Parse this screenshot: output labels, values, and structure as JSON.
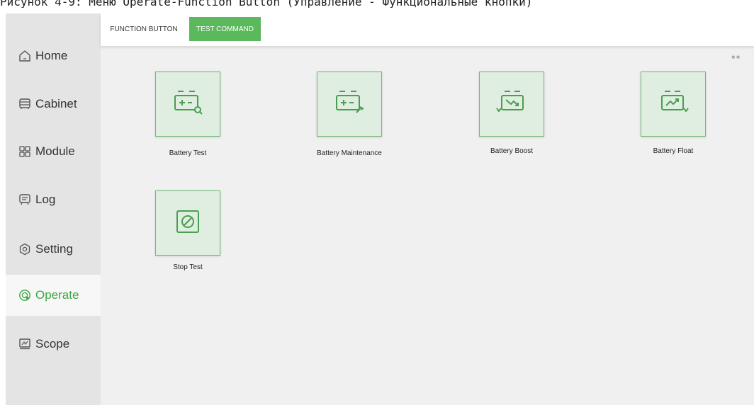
{
  "caption": "Рисунок 4-9: Меню Operate-Function Button (Управление - Функциональные кнопки)",
  "sidebar": {
    "items": [
      {
        "label": "Home",
        "icon": "home-icon"
      },
      {
        "label": "Cabinet",
        "icon": "cabinet-icon"
      },
      {
        "label": "Module",
        "icon": "module-icon"
      },
      {
        "label": "Log",
        "icon": "log-icon"
      },
      {
        "label": "Setting",
        "icon": "setting-icon"
      },
      {
        "label": "Operate",
        "icon": "operate-icon",
        "active": true
      },
      {
        "label": "Scope",
        "icon": "scope-icon"
      }
    ]
  },
  "tabs": [
    {
      "label": "FUNCTION BUTTON",
      "active": false
    },
    {
      "label": "TEST COMMAND",
      "active": true
    }
  ],
  "buttons": [
    {
      "label": "Battery Test",
      "icon": "battery-test-icon"
    },
    {
      "label": "Battery Maintenance",
      "icon": "battery-maintenance-icon"
    },
    {
      "label": "Battery Boost",
      "icon": "battery-boost-icon"
    },
    {
      "label": "Battery Float",
      "icon": "battery-float-icon"
    },
    {
      "label": "Stop Test",
      "icon": "stop-test-icon"
    }
  ],
  "colors": {
    "accent": "#5cb85c",
    "active_text": "#3fa546",
    "tile_bg": "#dfeee0",
    "tile_border": "#6fba73",
    "icon_stroke": "#4a9e50"
  }
}
